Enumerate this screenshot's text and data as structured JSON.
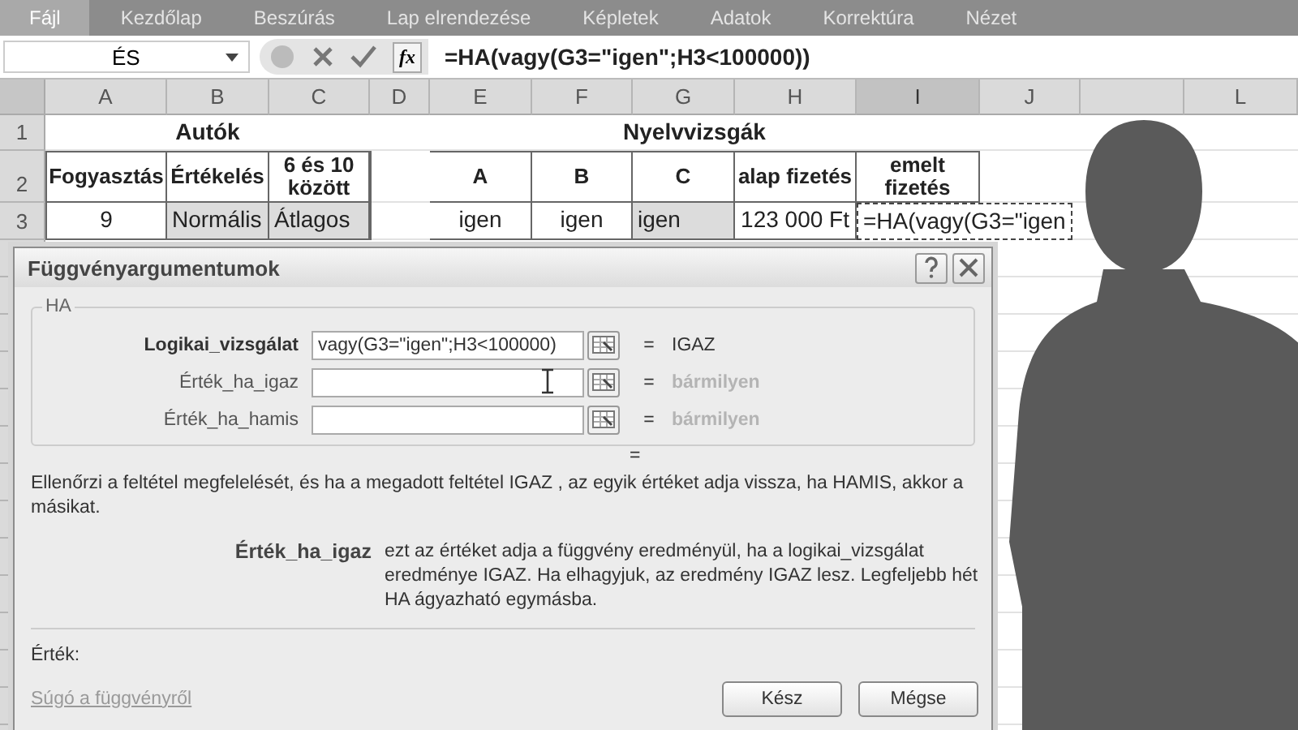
{
  "ribbon_tabs": [
    {
      "label": "Fájl",
      "selected": true
    },
    {
      "label": "Kezdőlap",
      "selected": false
    },
    {
      "label": "Beszúrás",
      "selected": false
    },
    {
      "label": "Lap elrendezése",
      "selected": false
    },
    {
      "label": "Képletek",
      "selected": false
    },
    {
      "label": "Adatok",
      "selected": false
    },
    {
      "label": "Korrektúra",
      "selected": false
    },
    {
      "label": "Nézet",
      "selected": false
    }
  ],
  "formula_bar": {
    "name_box": "ÉS",
    "function_button": "fx",
    "formula": "=HA(vagy(G3=\"igen\";H3<100000))"
  },
  "sheet": {
    "columns": [
      {
        "label": "A",
        "selected": false
      },
      {
        "label": "B",
        "selected": false
      },
      {
        "label": "C",
        "selected": false
      },
      {
        "label": "D",
        "selected": false
      },
      {
        "label": "E",
        "selected": false
      },
      {
        "label": "F",
        "selected": false
      },
      {
        "label": "G",
        "selected": false
      },
      {
        "label": "H",
        "selected": false
      },
      {
        "label": "I",
        "selected": true
      },
      {
        "label": "J",
        "selected": false
      },
      {
        "selected": false
      },
      {
        "label": "L",
        "selected": false
      }
    ],
    "rows": [
      {
        "number": "1",
        "kind": "title",
        "cells": [
          {
            "text": ""
          },
          {
            "text": "Autók"
          },
          {
            "text": ""
          },
          {
            "text": ""
          },
          {
            "text": ""
          },
          {
            "text": ""
          },
          {
            "text": "Nyelvvizsgák"
          },
          {
            "text": ""
          },
          {
            "text": ""
          }
        ]
      },
      {
        "number": "2",
        "kind": "header",
        "cells": [
          {
            "text": "Fogyasztás"
          },
          {
            "text": "Értékelés"
          },
          {
            "text": "6 és 10 között"
          },
          {
            "text": ""
          },
          {
            "text": "A"
          },
          {
            "text": "B"
          },
          {
            "text": "C"
          },
          {
            "text": "alap fizetés"
          },
          {
            "text": "emelt fizetés"
          }
        ]
      },
      {
        "number": "3",
        "kind": "data",
        "cells": [
          {
            "text": "9",
            "shaded": false,
            "editing": false
          },
          {
            "text": "Normális",
            "shaded": true,
            "editing": false
          },
          {
            "text": "Átlagos",
            "shaded": true,
            "editing": false
          },
          {
            "text": "",
            "shaded": false,
            "editing": false
          },
          {
            "text": "igen",
            "shaded": false,
            "editing": false
          },
          {
            "text": "igen",
            "shaded": false,
            "editing": false
          },
          {
            "text": "igen",
            "shaded": true,
            "editing": false
          },
          {
            "text": "123 000 Ft",
            "shaded": false,
            "editing": false
          },
          {
            "text": "=HA(vagy(G3=\"igen",
            "shaded": false,
            "editing": true
          }
        ]
      }
    ]
  },
  "dialog": {
    "title": "Függvényargumentumok",
    "function_name": "HA",
    "arguments": [
      {
        "label": "Logikai_vizsgálat",
        "required": true,
        "value": "vagy(G3=\"igen\";H3<100000)",
        "equals": "=",
        "result": "IGAZ",
        "result_dimmed": false,
        "pointer_over": false
      },
      {
        "label": "Érték_ha_igaz",
        "required": false,
        "equals": "=",
        "result": "bármilyen",
        "result_dimmed": true,
        "pointer_over": true
      },
      {
        "label": "Érték_ha_hamis",
        "required": false,
        "equals": "=",
        "result": "bármilyen",
        "result_dimmed": true,
        "pointer_over": false
      }
    ],
    "result_equals": "=",
    "description": "Ellenőrzi a feltétel megfelelését, és ha a megadott feltétel IGAZ , az egyik értéket adja vissza, ha HAMIS, akkor a másikat.",
    "argument_help": {
      "label": "Érték_ha_igaz",
      "text": "ezt az értéket adja a függvény eredményül, ha a logikai_vizsgálat eredménye IGAZ. Ha elhagyjuk, az eredmény IGAZ lesz. Legfeljebb hét HA ágyazható egymásba."
    },
    "value_label": "Érték:",
    "help_link": "Súgó a függvényről",
    "buttons": [
      "Kész",
      "Mégse"
    ]
  }
}
